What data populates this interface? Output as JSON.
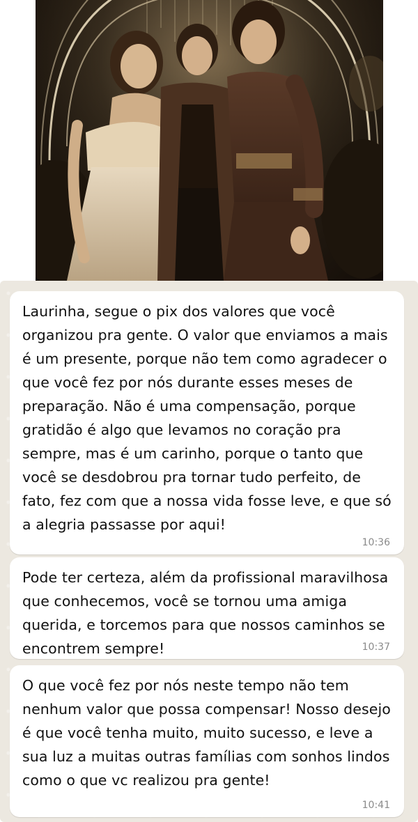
{
  "photo": {
    "alt": "Foto em sépia de três mulheres posando juntas em uma festa"
  },
  "messages": [
    {
      "text": "Laurinha, segue o pix dos valores que você organizou pra gente. O valor que enviamos a mais é um presente, porque não tem como agradecer o que você fez por nós durante esses meses de preparação. Não é uma compensação, porque gratidão é algo que levamos no coração pra sempre, mas é um carinho, porque o tanto que você se desdobrou pra tornar tudo perfeito, de fato, fez com que a nossa vida fosse leve, e que só a alegria passasse por aqui!",
      "time": "10:36"
    },
    {
      "text": "Pode ter certeza, além da profissional maravilhosa que conhecemos, você se tornou uma amiga querida, e torcemos para que nossos caminhos se encontrem sempre!",
      "time": "10:37"
    },
    {
      "text": "O que você fez por nós neste tempo não tem nenhum valor que possa compensar! Nosso desejo é que você tenha muito, muito sucesso, e leve a sua luz a muitas outras famílias com sonhos lindos como o que vc realizou pra gente!",
      "time": "10:41"
    }
  ],
  "colors": {
    "chat_background": "#ece8e0",
    "bubble": "#ffffff",
    "timestamp": "#8a8a8a",
    "photo_tone": "sepia"
  }
}
